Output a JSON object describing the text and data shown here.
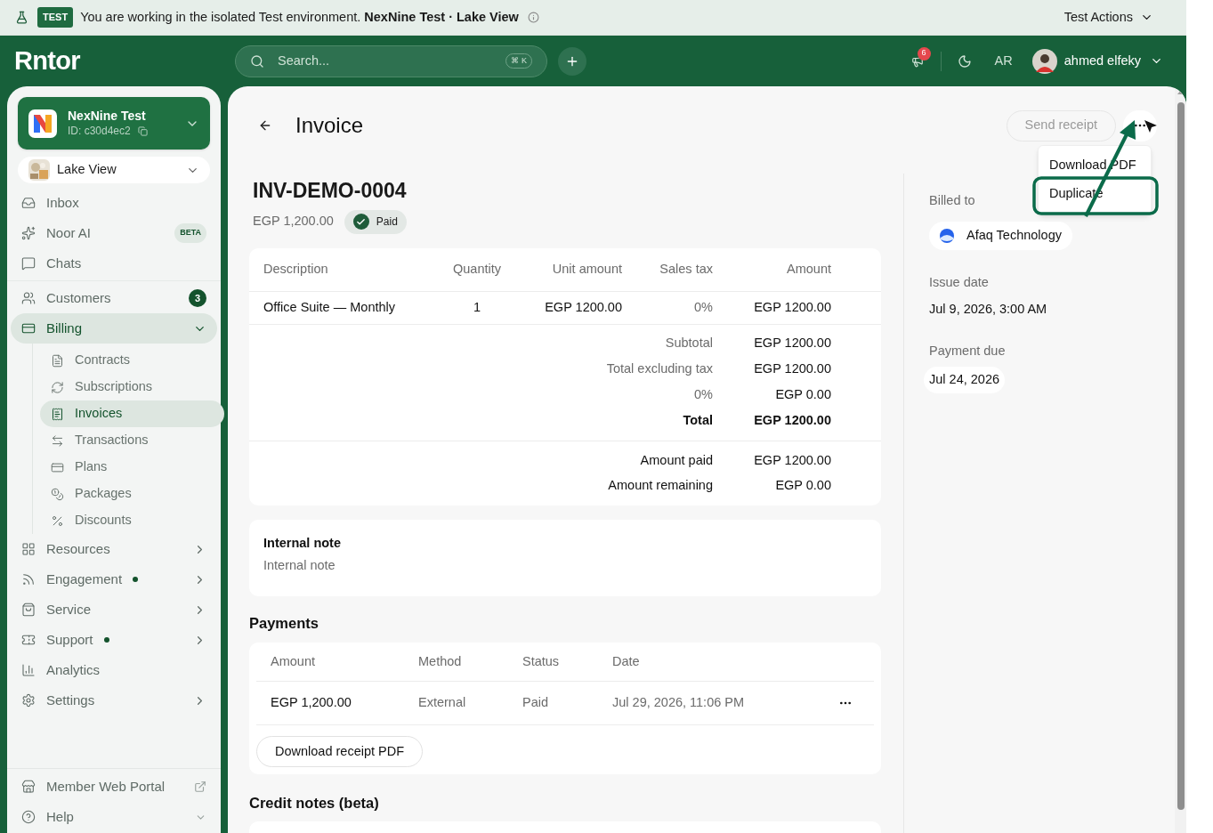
{
  "banner": {
    "badge": "TEST",
    "message": "You are working in the isolated Test environment. **NexNine Test · Lake View**",
    "actions": "Test Actions"
  },
  "header": {
    "logo": "Rntor",
    "search_placeholder": "Search...",
    "shortcut": "⌘ K",
    "notifications": "6",
    "language": "AR",
    "user": "ahmed elfeky"
  },
  "sidebar": {
    "org": {
      "name": "NexNine Test",
      "id": "ID: c30d4ec2"
    },
    "location": "Lake View",
    "groups": [
      [
        {
          "label": "Inbox",
          "selected": false
        },
        {
          "label": "Noor AI",
          "selected": false,
          "badge": "BETA",
          "kind": "beta"
        },
        {
          "label": "Chats",
          "selected": false
        }
      ],
      [
        {
          "label": "Customers",
          "selected": false,
          "badge": "3",
          "kind": "count"
        },
        {
          "label": "Billing",
          "selected": true,
          "expanded": true,
          "children": [
            {
              "label": "Contracts",
              "selected": false
            },
            {
              "label": "Subscriptions",
              "selected": false
            },
            {
              "label": "Invoices",
              "selected": true
            },
            {
              "label": "Transactions",
              "selected": false
            },
            {
              "label": "Plans",
              "selected": false
            },
            {
              "label": "Packages",
              "selected": false
            },
            {
              "label": "Discounts",
              "selected": false
            }
          ]
        },
        {
          "label": "Resources",
          "selected": false,
          "expanded": false
        },
        {
          "label": "Engagement",
          "selected": false,
          "expanded": false,
          "color": "#14532d"
        },
        {
          "label": "Service",
          "selected": false,
          "expanded": false
        },
        {
          "label": "Support",
          "selected": false,
          "expanded": false,
          "color": "#14532d"
        },
        {
          "label": "Analytics",
          "selected": false
        },
        {
          "label": "Settings",
          "selected": false,
          "expanded": false
        }
      ]
    ],
    "footer": [
      {
        "label": "Member Web Portal",
        "kind": "external"
      },
      {
        "label": "Help",
        "kind": "menu"
      }
    ]
  },
  "page": {
    "title": "Invoice",
    "send_receipt": "Send receipt",
    "menu": [
      "Download PDF",
      "Duplicate"
    ],
    "number": "INV-DEMO-0004",
    "amount": "EGP 1,200.00",
    "status": "Paid",
    "lines": {
      "columns": [
        "Description",
        "Quantity",
        "Unit amount",
        "Sales tax",
        "Amount"
      ],
      "rows": [
        [
          "Office Suite — Monthly",
          "1",
          "EGP 1200.00",
          "0%",
          "EGP 1200.00"
        ]
      ]
    },
    "summary": [
      {
        "label": "Subtotal",
        "value": "EGP 1200.00",
        "kind": "muted"
      },
      {
        "label": "Total excluding tax",
        "value": "EGP 1200.00",
        "kind": "muted"
      },
      {
        "label": "0%",
        "value": "EGP 0.00",
        "kind": "muted"
      },
      {
        "label": "Total",
        "value": "EGP 1200.00",
        "kind": "total"
      }
    ],
    "paid": [
      {
        "label": "Amount paid",
        "value": "EGP 1200.00",
        "kind": "plain"
      },
      {
        "label": "Amount remaining",
        "value": "EGP 0.00",
        "kind": "plain"
      }
    ],
    "note": {
      "title": "Internal note",
      "body": "Internal note"
    },
    "payments": {
      "title": "Payments",
      "columns": [
        "Amount",
        "Method",
        "Status",
        "Date"
      ],
      "rows": [
        [
          "EGP 1,200.00",
          "External",
          "Paid",
          "Jul 29, 2026, 11:06 PM"
        ]
      ],
      "button": "Download receipt PDF"
    },
    "credit_notes": {
      "title": "Credit notes (beta)"
    },
    "details": [
      {
        "label": "Billed to",
        "value": "Afaq Technology",
        "kind": "customer"
      },
      {
        "label": "Issue date",
        "value": "Jul 9, 2026, 3:00 AM",
        "kind": "plain"
      },
      {
        "label": "Payment due",
        "value": "Jul 24, 2026",
        "kind": "chip"
      }
    ]
  }
}
